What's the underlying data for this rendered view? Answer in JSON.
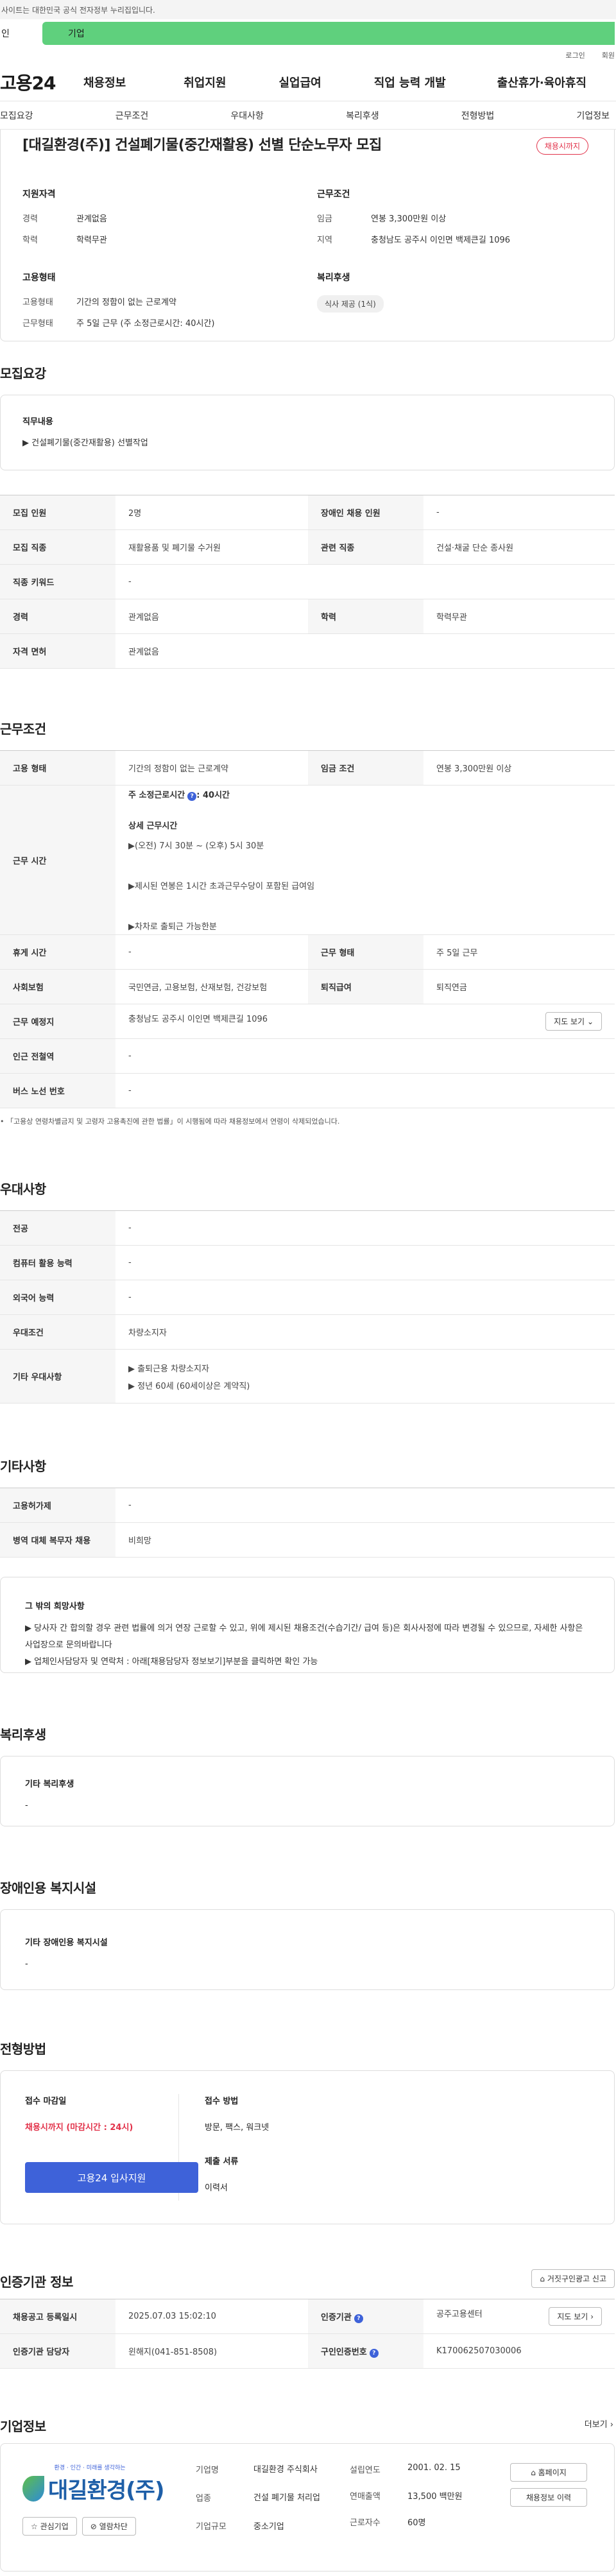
{
  "notice": "사이트는 대한민국 공식 전자정부 누리집입니다.",
  "top_tabs": {
    "main": "인",
    "biz": "기업"
  },
  "util": {
    "login": "로그인",
    "join": "회원"
  },
  "logo": "고용24",
  "gnb": [
    "채용정보",
    "취업지원",
    "실업급여",
    "직업 능력 개발",
    "출산휴가·육아휴직"
  ],
  "subtabs": [
    "모집요강",
    "근무조건",
    "우대사항",
    "복리후생",
    "전형방법",
    "기업정보"
  ],
  "job": {
    "title": "[대길환경(주)] 건설폐기물(중간재활용) 선별 단순노무자 모집",
    "status_badge": "채용시까지",
    "summary": {
      "qual_title": "지원자격",
      "career_label": "경력",
      "career": "관계없음",
      "edu_label": "학력",
      "edu": "학력무관",
      "emp_title": "고용형태",
      "emptype_label": "고용형태",
      "emptype": "기간의 정함이 없는 근로계약",
      "worktype_label": "근무형태",
      "worktype": "주 5일 근무 (주 소정근로시간: 40시간)",
      "cond_title": "근무조건",
      "wage_label": "임금",
      "wage": "연봉 3,300만원 이상",
      "region_label": "지역",
      "region": "충청남도 공주시 이인면 백제큰길 1096",
      "welfare_title": "복리후생",
      "welfare_chip": "식사 제공 (1식)"
    }
  },
  "recruit": {
    "section_title": "모집요강",
    "duty_title": "직무내용",
    "duty_text": "▶ 건설폐기물(중간재활용) 선별작업",
    "rows": [
      [
        {
          "h": "모집 인원",
          "v": "2명"
        },
        {
          "h": "장애인 채용 인원",
          "v": "-"
        }
      ],
      [
        {
          "h": "모집 직종",
          "v": "재활용품 및 폐기물 수거원"
        },
        {
          "h": "관련 직종",
          "v": "건설·채굴 단순 종사원"
        }
      ],
      [
        {
          "h": "직종 키워드",
          "v": "-"
        }
      ],
      [
        {
          "h": "경력",
          "v": "관계없음"
        },
        {
          "h": "학력",
          "v": "학력무관"
        }
      ],
      [
        {
          "h": "자격 면허",
          "v": "관계없음"
        }
      ]
    ]
  },
  "cond": {
    "section_title": "근무조건",
    "emptype_h": "고용 형태",
    "emptype_v": "기간의 정함이 없는 근로계약",
    "wage_h": "임금 조건",
    "wage_v": "연봉 3,300만원 이상",
    "worktime_h": "근무 시간",
    "worktime_week": "주 소정근로시간",
    "worktime_hours": ": 40시간",
    "detail_title": "상세 근무시간",
    "detail_1": "▶(오전) 7시 30분 ~ (오후) 5시 30분",
    "detail_2": "▶제시된 연봉은 1시간 초과근무수당이 포함된 급여임",
    "detail_3": "▶차차로 출퇴근 가능한분",
    "holiday_h": "휴게 시간",
    "holiday_v": "-",
    "worktype_h": "근무 형태",
    "worktype_v": "주 5일 근무",
    "insurance_h": "사회보험",
    "insurance_v": "국민연금, 고용보험, 산재보험, 건강보험",
    "retire_h": "퇴직급여",
    "retire_v": "퇴직연금",
    "place_h": "근무 예정지",
    "place_v": "충청남도 공주시 이인면 백제큰길 1096",
    "map_btn": "지도 보기",
    "station_h": "인근 전철역",
    "station_v": "-",
    "bus_h": "버스 노선 번호",
    "bus_v": "-",
    "note": "「고용상 연령차별금지 및 고령자 고용촉진에 관한 법률」이 시행됨에 따라 채용정보에서 연령이 삭제되었습니다."
  },
  "pref": {
    "section_title": "우대사항",
    "rows": [
      {
        "h": "전공",
        "v": "-"
      },
      {
        "h": "컴퓨터 활용 능력",
        "v": "-"
      },
      {
        "h": "외국어 능력",
        "v": "-"
      },
      {
        "h": "우대조건",
        "v": "차량소지자"
      }
    ],
    "other_h": "기타 우대사항",
    "other_1": "▶ 출퇴근용 차량소지자",
    "other_2": "▶ 정년 60세 (60세이상은 계약직)"
  },
  "etc": {
    "section_title": "기타사항",
    "rows": [
      {
        "h": "고용허가제",
        "v": "-"
      },
      {
        "h": "병역 대체 복무자 채용",
        "v": "비희망"
      }
    ],
    "box_title": "그 밖의 희망사항",
    "box_1": "▶ 당사자 간 합의할 경우 관련 법률에 의거 연장 근로할 수 있고, 위에 제시된 채용조건(수습기간/ 급여 등)은 회사사정에 따라 변경될 수 있으므로, 자세한 사항은 사업장으로 문의바랍니다",
    "box_2": "▶ 업체인사담당자 및 연락처 : 아래[채용담당자 정보보기]부분을 클릭하면 확인 가능"
  },
  "welfare": {
    "section_title": "복리후생",
    "box_title": "기타 복리후생",
    "box_value": "-"
  },
  "disabled": {
    "section_title": "장애인용 복지시설",
    "box_title": "기타 장애인용 복지시설",
    "box_value": "-"
  },
  "process": {
    "section_title": "전형방법",
    "deadline_title": "접수 마감일",
    "deadline_value": "채용시까지 (마감시간 : 24시)",
    "apply_btn": "고용24 입사지원",
    "method_title": "접수 방법",
    "method_value": "방문, 팩스, 워크넷",
    "docs_title": "제출 서류",
    "docs_value": "이력서"
  },
  "agency": {
    "section_title": "인증기관 정보",
    "report_btn": "거짓구인광고 신고",
    "reg_h": "채용공고 등록일시",
    "reg_v": "2025.07.03 15:02:10",
    "inst_h": "인증기관",
    "inst_v": "공주고용센터",
    "map_btn": "지도 보기",
    "mgr_h": "인증기관 담당자",
    "mgr_v": "윈해지(041-851-8508)",
    "num_h": "구인인증번호",
    "num_v": "K170062507030006"
  },
  "company": {
    "section_title": "기업정보",
    "more": "더보기",
    "logo_tag": "환경 · 인간 · 미래를 생각하는",
    "logo_name": "대길환경(주)",
    "fav_btn": "관심기업",
    "block_btn": "열람차단",
    "name_h": "기업명",
    "name_v": "대길환경 주식회사",
    "industry_h": "업종",
    "industry_v": "건설 폐기물 처리업",
    "scale_h": "기업규모",
    "scale_v": "중소기업",
    "founded_h": "설립연도",
    "founded_v": "2001. 02. 15",
    "sales_h": "연매출액",
    "sales_v": "13,500 백만원",
    "staff_h": "근로자수",
    "staff_v": "60명",
    "home_btn": "홈페이지",
    "history_btn": "채용정보 이력"
  }
}
